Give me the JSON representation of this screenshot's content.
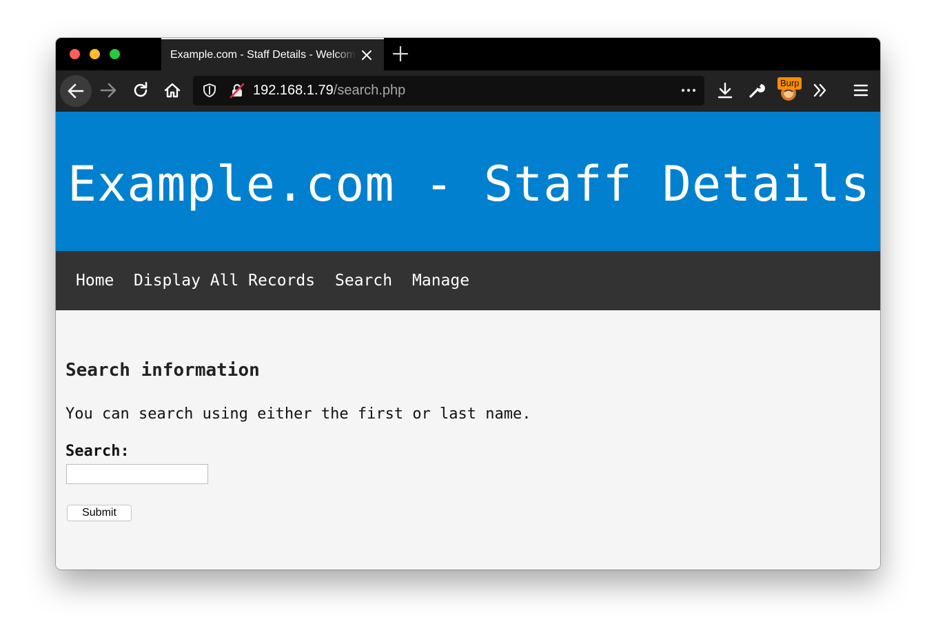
{
  "browser": {
    "tab": {
      "title": "Example.com - Staff Details - Welcome"
    },
    "url": {
      "host": "192.168.1.79",
      "path": "/search.php"
    },
    "extension_badge": "Burp",
    "icons": {
      "back": "arrow-left-icon",
      "forward": "arrow-right-icon",
      "reload": "reload-icon",
      "home": "home-icon",
      "shield": "shield-icon",
      "insecure": "insecure-lock-icon",
      "page_actions": "more-dots-icon",
      "downloads": "download-icon",
      "tools": "wrench-icon",
      "extension": "burp-icon",
      "overflow": "chevrons-right-icon",
      "menu": "hamburger-icon",
      "close_tab": "close-icon",
      "new_tab": "plus-icon"
    }
  },
  "site": {
    "title": "Example.com - Staff Details",
    "nav": [
      "Home",
      "Display All Records",
      "Search",
      "Manage"
    ]
  },
  "content": {
    "heading": "Search information",
    "description": "You can search using either the first or last name.",
    "search_label": "Search:",
    "search_value": "",
    "submit_label": "Submit"
  },
  "colors": {
    "header_bg": "#0080cf",
    "nav_bg": "#333333",
    "page_bg": "#f5f5f5",
    "toolbar_bg": "#232323",
    "badge_bg": "#ff8c00"
  }
}
